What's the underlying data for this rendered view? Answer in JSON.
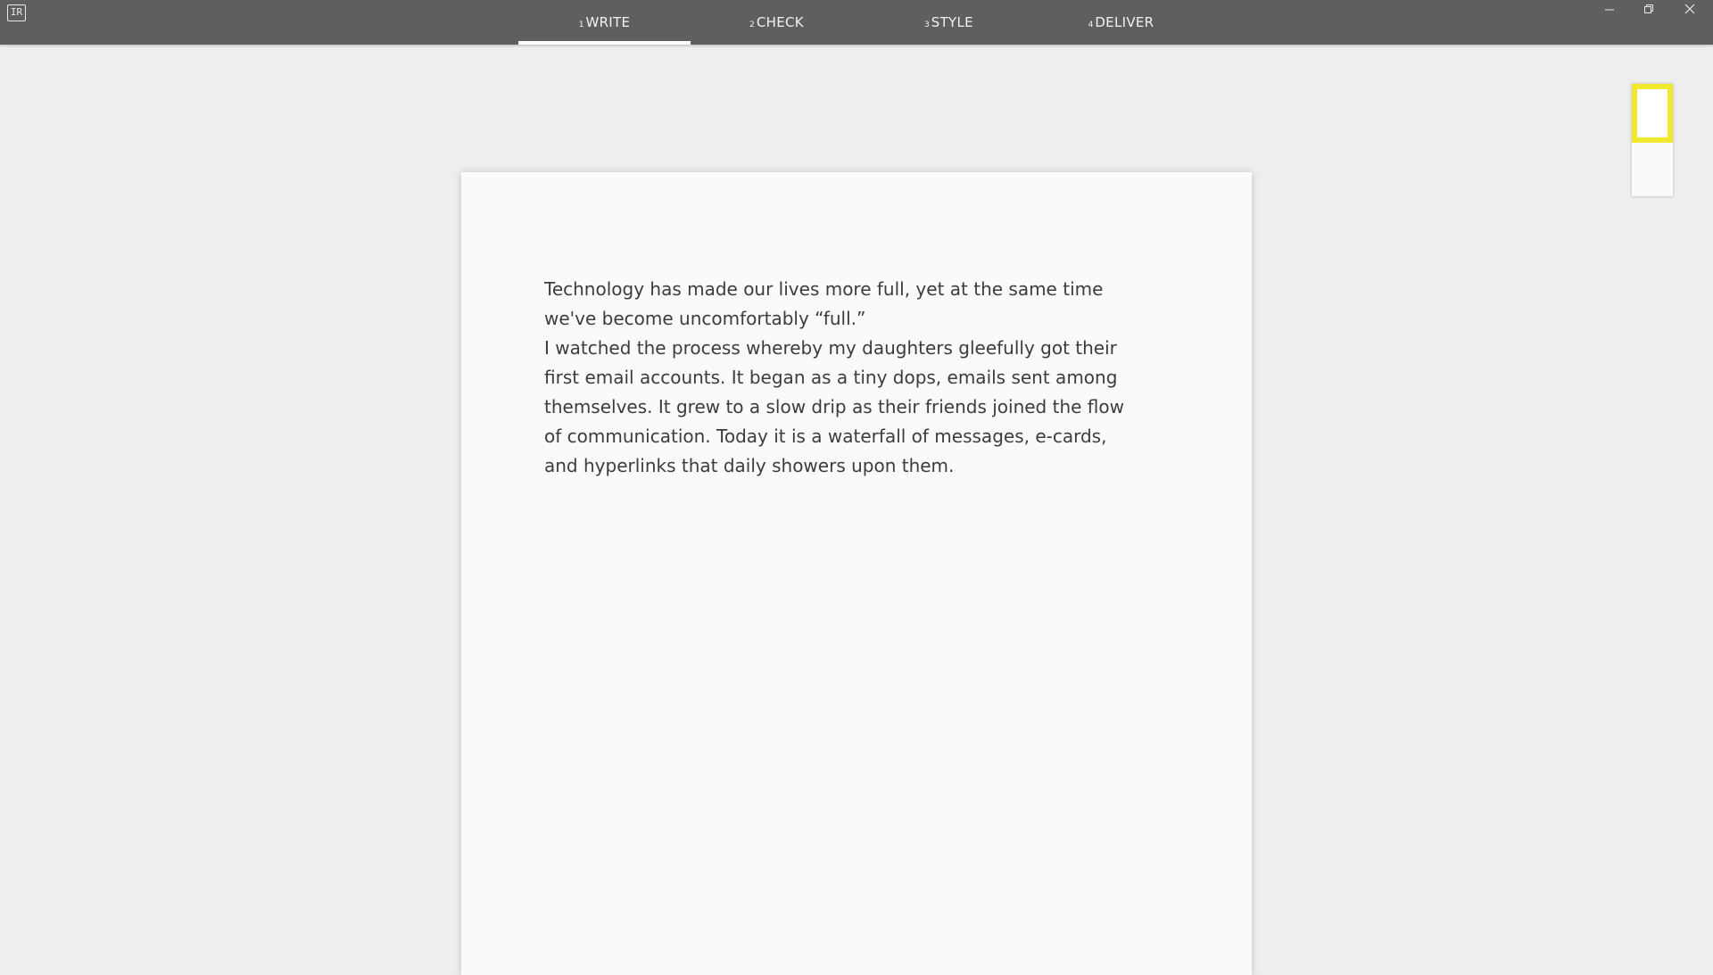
{
  "app": {
    "logo_text": "IR"
  },
  "tabs": [
    {
      "num": "1",
      "label": "WRITE",
      "active": true
    },
    {
      "num": "2",
      "label": "CHECK",
      "active": false
    },
    {
      "num": "3",
      "label": "STYLE",
      "active": false
    },
    {
      "num": "4",
      "label": "DELIVER",
      "active": false
    }
  ],
  "window_controls": {
    "minimize_icon": "minimize-icon",
    "restore_icon": "restore-icon",
    "close_icon": "close-icon"
  },
  "document": {
    "paragraph_1": "Technology has made our lives more full, yet at the same time\nwe've become uncomfortably “full.”",
    "paragraph_2": "I watched the process whereby my daughters gleefully got their\nfirst email accounts. It began as a tiny dops, emails sent among\nthemselves. It grew to a slow drip as their friends joined the flow\nof communication. Today it is a waterfall of messages, e-cards,\nand hyperlinks that daily showers upon them."
  },
  "colors": {
    "titlebar": "#5f5f5f",
    "background": "#eeeeee",
    "page": "#fafafa",
    "highlight": "#f2e830"
  }
}
